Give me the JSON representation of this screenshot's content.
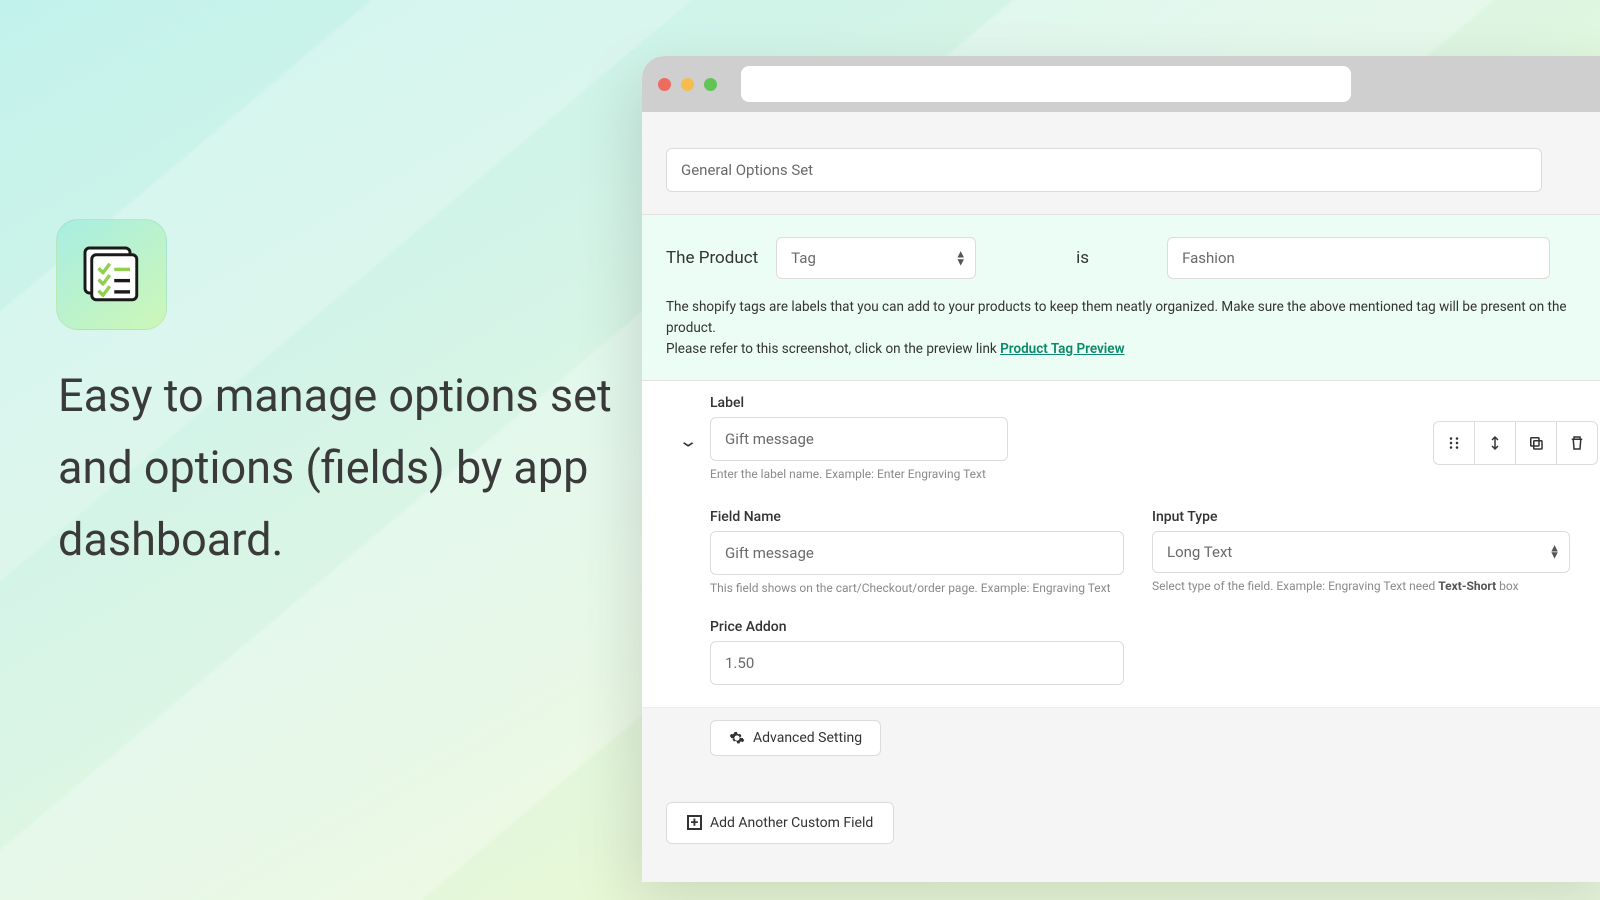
{
  "left": {
    "tagline": "Easy to manage options set and options (fields) by app dashboard."
  },
  "form": {
    "general_value": "General Options Set",
    "cond": {
      "label_product": "The Product",
      "scope_value": "Tag",
      "is_label": "is",
      "tag_value": "Fashion"
    },
    "tag_desc_1": "The shopify tags are labels that you can add to your products to keep them neatly organized. Make sure the above mentioned tag will be present on the product.",
    "tag_desc_2_prefix": "Please refer to this screenshot, click on the preview link ",
    "tag_desc_link": "Product Tag Preview",
    "label_section": {
      "label": "Label",
      "value": "Gift message",
      "hint": "Enter the label name. Example: Enter Engraving Text"
    },
    "field_name": {
      "label": "Field Name",
      "value": "Gift message",
      "hint": "This field shows on the cart/Checkout/order page. Example: Engraving Text"
    },
    "input_type": {
      "label": "Input Type",
      "value": "Long Text",
      "hint_prefix": "Select type of the field. Example: Engraving Text need ",
      "hint_bold": "Text-Short",
      "hint_suffix": " box"
    },
    "price_addon": {
      "label": "Price Addon",
      "value": "1.50"
    },
    "advanced_label": "Advanced Setting",
    "add_another_label": "Add Another Custom Field"
  }
}
